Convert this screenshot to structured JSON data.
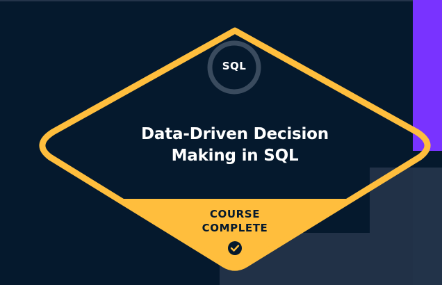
{
  "badge": {
    "skill_tag": "SQL",
    "title_line1": "Data-Driven Decision",
    "title_line2": "Making in SQL",
    "status_line1": "COURSE",
    "status_line2": "COMPLETE"
  },
  "colors": {
    "background": "#05192d",
    "accent_yellow": "#ffbe3d",
    "accent_purple": "#7933ff",
    "panel_slate": "#213147",
    "text_light": "#ffffff"
  },
  "icons": {
    "status": "check-circle-icon"
  }
}
